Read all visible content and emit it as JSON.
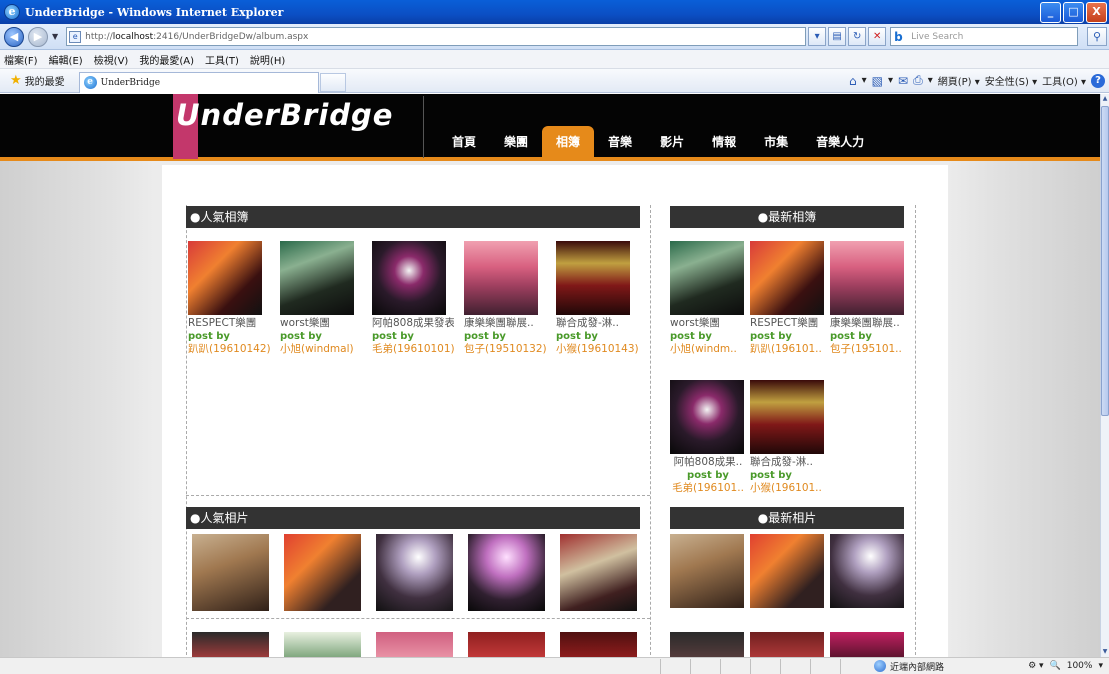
{
  "window": {
    "title": "UnderBridge - Windows Internet Explorer",
    "minimize": "_",
    "maximize": "□",
    "close": "X"
  },
  "address": {
    "url_prefix": "http://",
    "url_host": "localhost",
    "url_rest": ":2416/UnderBridgeDw/album.aspx",
    "search_placeholder": "Live Search"
  },
  "menu": [
    "檔案(F)",
    "編輯(E)",
    "檢視(V)",
    "我的最愛(A)",
    "工具(T)",
    "說明(H)"
  ],
  "favorites": {
    "label": "我的最愛",
    "tab_title": "UnderBridge"
  },
  "commands": {
    "page": "網頁(P) ▾",
    "safety": "安全性(S) ▾",
    "tools": "工具(O) ▾"
  },
  "site": {
    "logo": "UnderBridge",
    "nav": [
      "首頁",
      "樂團",
      "相簿",
      "音樂",
      "影片",
      "情報",
      "市集",
      "音樂人力"
    ],
    "active_nav": "相簿"
  },
  "sections": {
    "popular_albums": "●人氣相簿",
    "latest_albums": "●最新相簿",
    "popular_photos": "●人氣相片",
    "latest_photos": "●最新相片"
  },
  "by_label": "post by",
  "popular_albums": [
    {
      "name": "RESPECT樂團",
      "poster": "趴趴(19610142)"
    },
    {
      "name": "worst樂團",
      "poster": "小旭(windmal)"
    },
    {
      "name": "阿帕808成果發表",
      "poster": "毛弟(19610101)"
    },
    {
      "name": "康樂樂團聯展..",
      "poster": "包子(19510132)"
    },
    {
      "name": "聯合成發-淋..",
      "poster": "小猴(19610143)"
    }
  ],
  "latest_albums": [
    {
      "name": "worst樂團",
      "poster": "小旭(windm.."
    },
    {
      "name": "RESPECT樂團",
      "poster": "趴趴(196101.."
    },
    {
      "name": "康樂樂團聯展..",
      "poster": "包子(195101.."
    },
    {
      "name": "阿帕808成果..",
      "poster": "毛弟(196101.."
    },
    {
      "name": "聯合成發-淋..",
      "poster": "小猴(196101.."
    }
  ],
  "status": {
    "zone": "近端內部網路",
    "zoom": "100%"
  },
  "colors": {
    "accent": "#e68a1a",
    "logo_bar": "#c3376b",
    "header_bg": "#040404",
    "section_bg": "#333333",
    "by_green": "#4a9a2a",
    "poster_orange": "#e08a20"
  }
}
